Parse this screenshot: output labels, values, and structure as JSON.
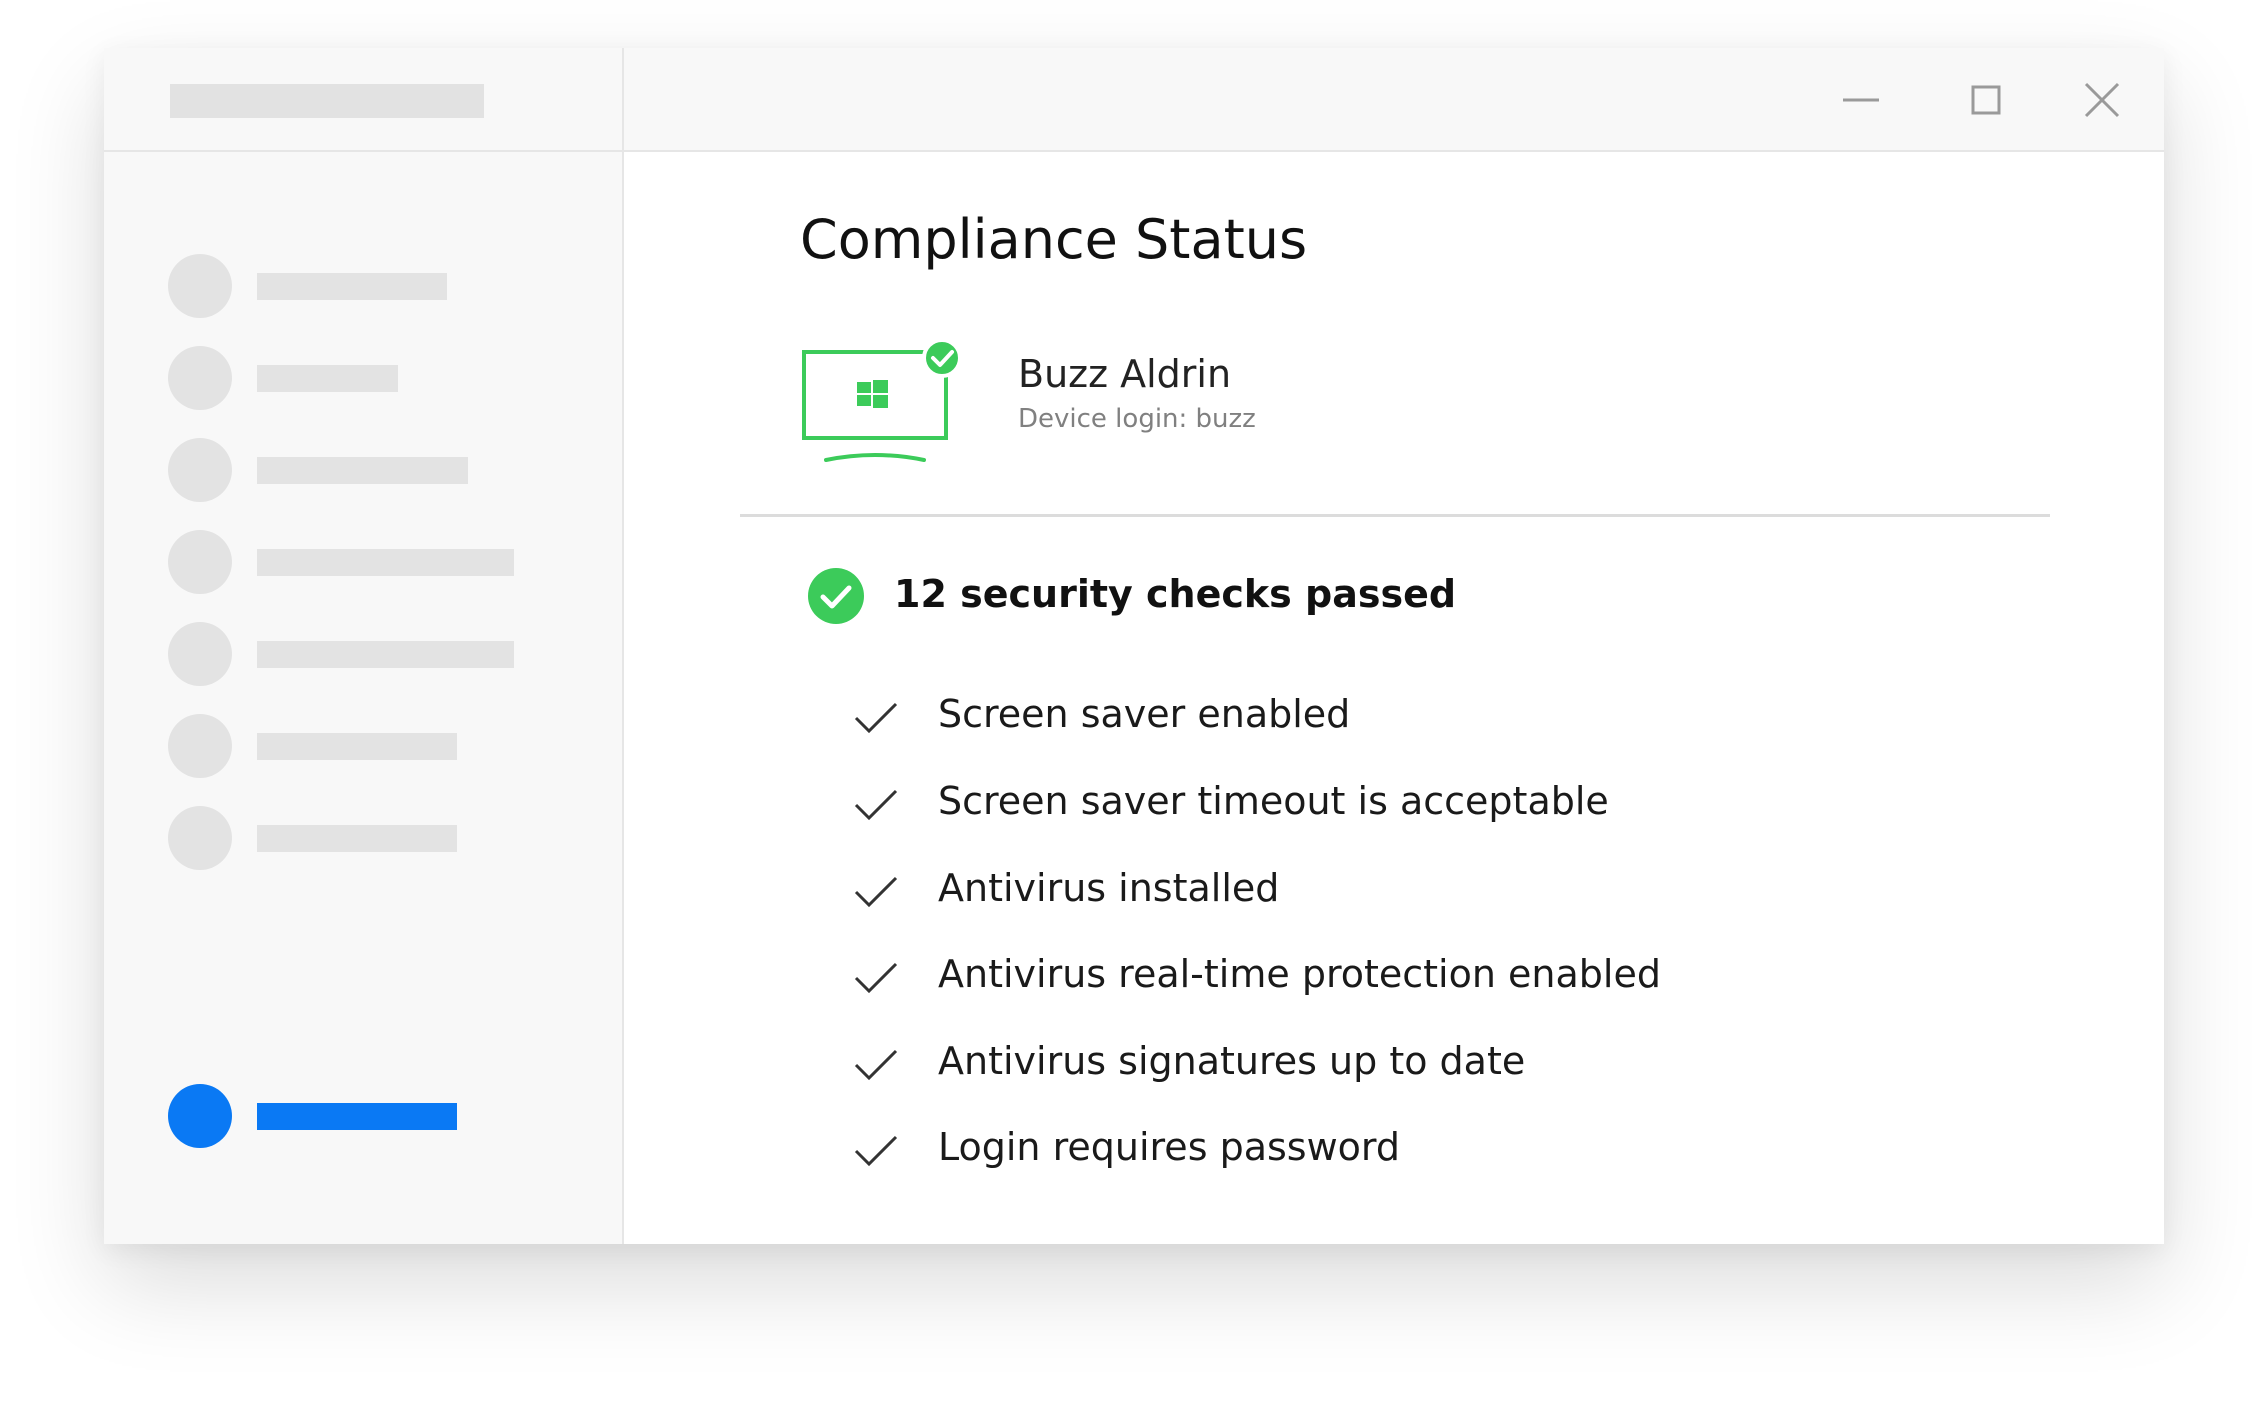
{
  "main": {
    "title": "Compliance Status",
    "device": {
      "user_name": "Buzz Aldrin",
      "login_text": "Device login: buzz",
      "status_color": "#3ccb5a"
    },
    "summary": {
      "text": "12 security checks passed"
    },
    "checks": [
      {
        "label": "Screen saver enabled"
      },
      {
        "label": "Screen saver timeout is acceptable"
      },
      {
        "label": "Antivirus installed"
      },
      {
        "label": "Antivirus real-time protection enabled"
      },
      {
        "label": "Antivirus signatures up to date"
      },
      {
        "label": "Login requires password"
      }
    ]
  },
  "titlebar": {
    "icons": [
      "minimize-icon",
      "maximize-icon",
      "close-icon"
    ]
  },
  "colors": {
    "accent": "#0a79f4",
    "success": "#3ccb5a",
    "placeholder": "#e3e3e3"
  }
}
